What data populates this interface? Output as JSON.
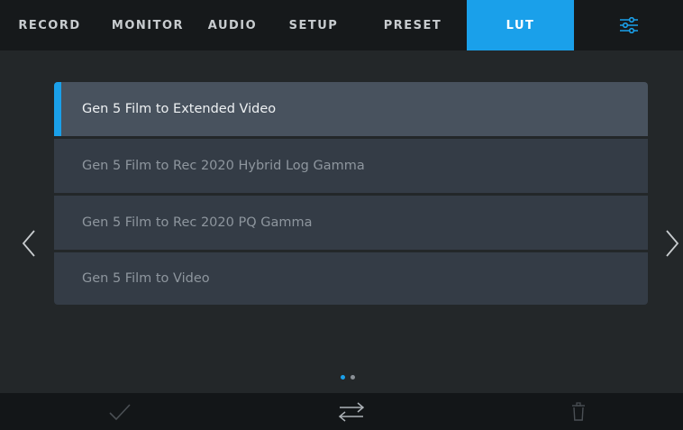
{
  "tabs": [
    {
      "label": "RECORD"
    },
    {
      "label": "MONITOR"
    },
    {
      "label": "AUDIO"
    },
    {
      "label": "SETUP"
    },
    {
      "label": "PRESET"
    },
    {
      "label": "LUT",
      "active": true
    }
  ],
  "settings_icon": "sliders-icon",
  "lut_list": {
    "items": [
      {
        "label": "Gen 5 Film to Extended Video",
        "selected": true
      },
      {
        "label": "Gen 5 Film to Rec 2020 Hybrid Log Gamma"
      },
      {
        "label": "Gen 5 Film to Rec 2020 PQ Gamma"
      },
      {
        "label": "Gen 5 Film to Video"
      }
    ]
  },
  "pagination": {
    "current_page": 1,
    "total_pages": 2
  },
  "bottom_bar": {
    "icons": [
      "checkmark-icon",
      "swap-arrows-icon",
      "trash-icon"
    ]
  },
  "colors": {
    "accent": "#1aa0ea",
    "background": "#232729",
    "tabbar": "#16191b",
    "list_item": "#343c46",
    "list_item_selected": "#48525e"
  }
}
